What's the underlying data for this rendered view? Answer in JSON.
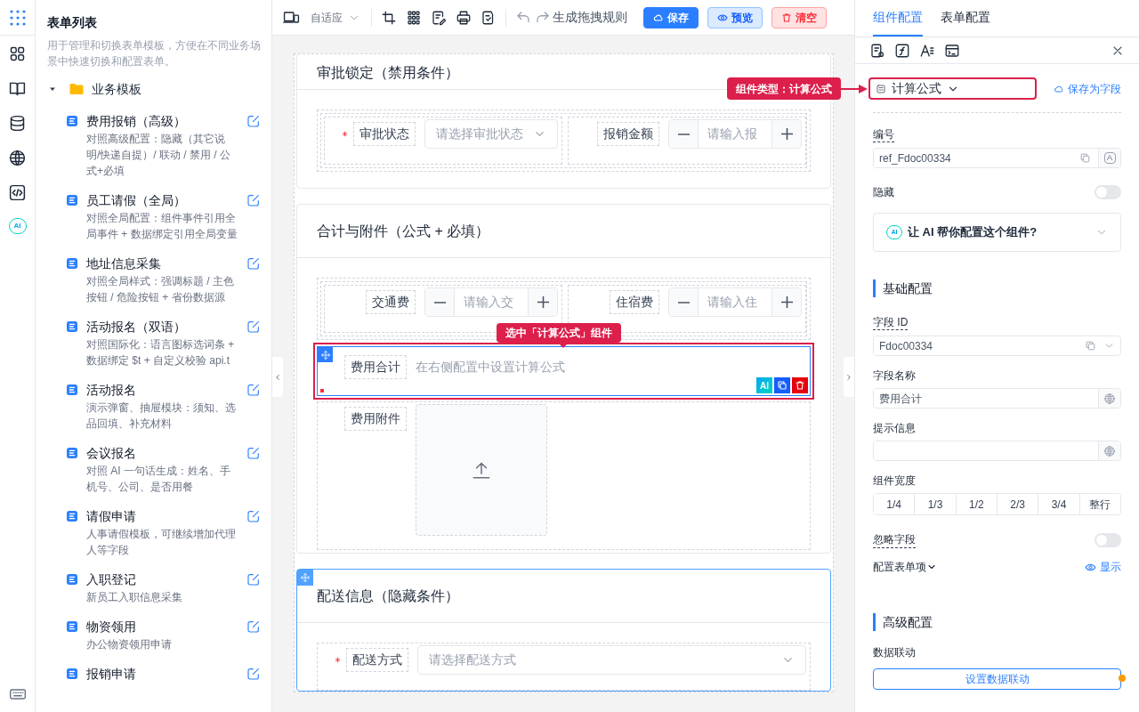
{
  "rail": {
    "ai_badge": "AI"
  },
  "list_panel": {
    "title": "表单列表",
    "description": "用于管理和切换表单模板，方便在不同业务场景中快速切换和配置表单。",
    "tree": [
      {
        "label": "业务模板",
        "expanded": true,
        "children": [
          {
            "title": "费用报销（高级）",
            "description": "对照高级配置：隐藏（其它说明/快递自提）/ 联动 / 禁用 / 公式+必填"
          },
          {
            "title": "员工请假（全局）",
            "description": "对照全局配置：组件事件引用全局事件 + 数据绑定引用全局变量"
          },
          {
            "title": "地址信息采集",
            "description": "对照全局样式：强调标题 / 主色按钮 / 危险按钮 + 省份数据源"
          },
          {
            "title": "活动报名（双语）",
            "description": "对照国际化：语言图标选词条 + 数据绑定 $t + 自定义校验 api.t"
          },
          {
            "title": "活动报名",
            "description": "演示弹窗、抽屉模块：须知、选品回填、补充材料"
          },
          {
            "title": "会议报名",
            "description": "对照 AI 一句话生成：姓名、手机号、公司、是否用餐"
          },
          {
            "title": "请假申请",
            "description": "人事请假模板，可继续增加代理人等字段"
          },
          {
            "title": "入职登记",
            "description": "新员工入职信息采集"
          },
          {
            "title": "物资领用",
            "description": "办公物资领用申请"
          },
          {
            "title": "报销申请"
          }
        ]
      }
    ]
  },
  "toolbar": {
    "layout_select": "自适应",
    "rule_button": "生成拖拽规则",
    "buttons": [
      {
        "label": "保存",
        "kind": "primary"
      },
      {
        "label": "预览",
        "kind": "secondary"
      },
      {
        "label": "清空",
        "kind": "danger"
      }
    ]
  },
  "sections": [
    {
      "title": "审批锁定（禁用条件）",
      "selected": false,
      "rows": [
        {
          "fields": [
            {
              "kind": "select",
              "label": "审批状态",
              "required": true,
              "placeholder": "请选择审批状态",
              "selected": false
            },
            {
              "kind": "stepper",
              "label": "报销金额",
              "required": false,
              "placeholder": "请输入报",
              "selected": false
            }
          ]
        }
      ]
    },
    {
      "title": "合计与附件（公式 + 必填）",
      "selected": false,
      "rows": [
        {
          "fields": [
            {
              "kind": "stepper",
              "label": "交通费",
              "required": false,
              "placeholder": "请输入交",
              "selected": false
            },
            {
              "kind": "stepper",
              "label": "住宿费",
              "required": false,
              "placeholder": "请输入住",
              "selected": false
            }
          ]
        },
        {
          "fields": [
            {
              "kind": "formula",
              "label": "费用合计",
              "required": false,
              "hint": "在右侧配置中设置计算公式",
              "action_badge": "AI",
              "selected": true
            }
          ]
        },
        {
          "fields": [
            {
              "kind": "upload",
              "label": "费用附件",
              "required": false,
              "selected": false
            }
          ]
        }
      ]
    },
    {
      "title": "配送信息（隐藏条件）",
      "selected": true,
      "rows": [
        {
          "fields": [
            {
              "kind": "select",
              "label": "配送方式",
              "required": true,
              "placeholder": "请选择配送方式",
              "selected": false
            }
          ]
        }
      ]
    }
  ],
  "annotations": [
    {
      "text": "组件类型：计算公式"
    },
    {
      "text": "选中「计算公式」组件"
    }
  ],
  "config": {
    "tabs": [
      {
        "label": "组件配置",
        "selected": true
      },
      {
        "label": "表单配置",
        "selected": false
      }
    ],
    "type_select": "计算公式",
    "save_as_field": "保存为字段",
    "code": {
      "label": "编号",
      "value": "ref_Fdoc00334",
      "badge": "A"
    },
    "hidden": {
      "label": "隐藏",
      "on": false
    },
    "ai_prompt": {
      "badge": "AI",
      "text": "让 AI 帮你配置这个组件?"
    },
    "basic_title": "基础配置",
    "field_id": {
      "label": "字段 ID",
      "value": "Fdoc00334"
    },
    "field_name": {
      "label": "字段名称",
      "value": "费用合计"
    },
    "hint": {
      "label": "提示信息"
    },
    "width": {
      "label": "组件宽度",
      "options": [
        {
          "label": "1/4",
          "selected": false
        },
        {
          "label": "1/3",
          "selected": false
        },
        {
          "label": "1/2",
          "selected": false
        },
        {
          "label": "2/3",
          "selected": false
        },
        {
          "label": "3/4",
          "selected": false
        },
        {
          "label": "整行",
          "selected": false
        }
      ]
    },
    "ignore": {
      "label": "忽略字段",
      "on": false
    },
    "form_items": {
      "label": "配置表单项",
      "action": "显示"
    },
    "advanced_title": "高级配置",
    "linkage": {
      "label": "数据联动",
      "button": "设置数据联动"
    }
  }
}
